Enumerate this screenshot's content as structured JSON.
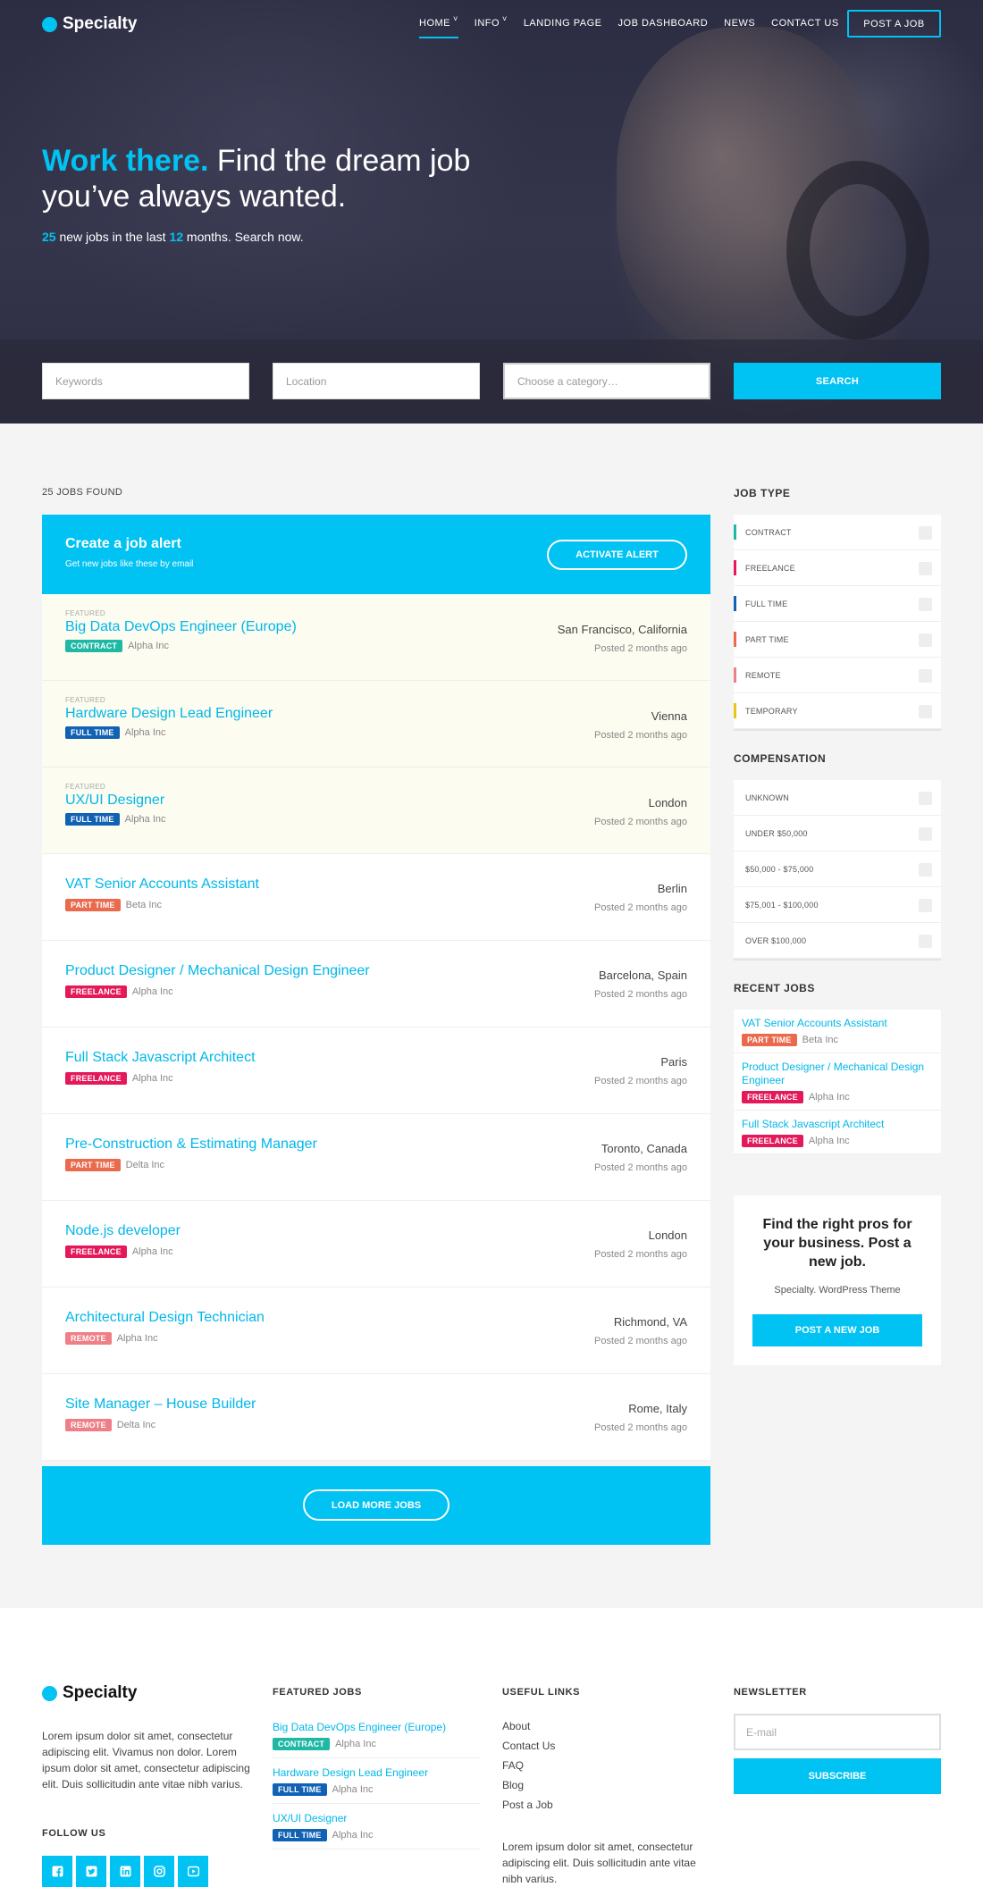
{
  "brand": {
    "name": "Specialty",
    "accent": "#00c2f3"
  },
  "nav": {
    "items": [
      {
        "label": "HOME",
        "has_dropdown": true,
        "active": true
      },
      {
        "label": "INFO",
        "has_dropdown": true,
        "active": false
      },
      {
        "label": "LANDING PAGE",
        "has_dropdown": false,
        "active": false
      },
      {
        "label": "JOB DASHBOARD",
        "has_dropdown": false,
        "active": false
      },
      {
        "label": "NEWS",
        "has_dropdown": false,
        "active": false
      },
      {
        "label": "CONTACT US",
        "has_dropdown": false,
        "active": false
      }
    ],
    "post_job_label": "POST A JOB"
  },
  "hero": {
    "title_accent": "Work there.",
    "title_rest": " Find the dream job you’ve always wanted.",
    "jobs_count": "25",
    "sub_part1": " new jobs in the last ",
    "months": "12",
    "sub_part2": " months. Search now."
  },
  "search": {
    "keywords_placeholder": "Keywords",
    "location_placeholder": "Location",
    "category_placeholder": "Choose a category…",
    "button_label": "SEARCH"
  },
  "results": {
    "count_label": "25 JOBS FOUND",
    "alert": {
      "title": "Create a job alert",
      "subtitle": "Get new jobs like these by email",
      "button_label": "ACTIVATE ALERT"
    },
    "featured_label": "FEATURED",
    "jobs": [
      {
        "title": "Big Data DevOps Engineer (Europe)",
        "type": "CONTRACT",
        "type_color": "#1fb8a5",
        "company": "Alpha Inc",
        "location": "San Francisco, California",
        "posted": "Posted 2 months ago",
        "featured": true
      },
      {
        "title": "Hardware Design Lead Engineer",
        "type": "FULL TIME",
        "type_color": "#1162b4",
        "company": "Alpha Inc",
        "location": "Vienna",
        "posted": "Posted 2 months ago",
        "featured": true
      },
      {
        "title": "UX/UI Designer",
        "type": "FULL TIME",
        "type_color": "#1162b4",
        "company": "Alpha Inc",
        "location": "London",
        "posted": "Posted 2 months ago",
        "featured": true
      },
      {
        "title": "VAT Senior Accounts Assistant",
        "type": "PART TIME",
        "type_color": "#ea6a4e",
        "company": "Beta Inc",
        "location": "Berlin",
        "posted": "Posted 2 months ago",
        "featured": false
      },
      {
        "title": "Product Designer / Mechanical Design Engineer",
        "type": "FREELANCE",
        "type_color": "#e3195a",
        "company": "Alpha Inc",
        "location": "Barcelona, Spain",
        "posted": "Posted 2 months ago",
        "featured": false
      },
      {
        "title": "Full Stack Javascript Architect",
        "type": "FREELANCE",
        "type_color": "#e3195a",
        "company": "Alpha Inc",
        "location": "Paris",
        "posted": "Posted 2 months ago",
        "featured": false
      },
      {
        "title": "Pre-Construction & Estimating Manager",
        "type": "PART TIME",
        "type_color": "#ea6a4e",
        "company": "Delta Inc",
        "location": "Toronto, Canada",
        "posted": "Posted 2 months ago",
        "featured": false
      },
      {
        "title": "Node.js developer",
        "type": "FREELANCE",
        "type_color": "#e3195a",
        "company": "Alpha Inc",
        "location": "London",
        "posted": "Posted 2 months ago",
        "featured": false
      },
      {
        "title": "Architectural Design Technician",
        "type": "REMOTE",
        "type_color": "#ef7f86",
        "company": "Alpha Inc",
        "location": "Richmond, VA",
        "posted": "Posted 2 months ago",
        "featured": false
      },
      {
        "title": "Site Manager – House Builder",
        "type": "REMOTE",
        "type_color": "#ef7f86",
        "company": "Delta Inc",
        "location": "Rome, Italy",
        "posted": "Posted 2 months ago",
        "featured": false
      }
    ],
    "load_more_label": "LOAD MORE JOBS"
  },
  "sidebar": {
    "job_type": {
      "heading": "JOB TYPE",
      "items": [
        {
          "label": "CONTRACT",
          "color": "#1fb8a5"
        },
        {
          "label": "FREELANCE",
          "color": "#e3195a"
        },
        {
          "label": "FULL TIME",
          "color": "#1162b4"
        },
        {
          "label": "PART TIME",
          "color": "#ea6a4e"
        },
        {
          "label": "REMOTE",
          "color": "#ef7f86"
        },
        {
          "label": "TEMPORARY",
          "color": "#e8c516"
        }
      ]
    },
    "compensation": {
      "heading": "COMPENSATION",
      "items": [
        {
          "label": "UNKNOWN"
        },
        {
          "label": "UNDER $50,000"
        },
        {
          "label": "$50,000 - $75,000"
        },
        {
          "label": "$75,001 - $100,000"
        },
        {
          "label": "OVER $100,000"
        }
      ]
    },
    "recent": {
      "heading": "RECENT JOBS",
      "items": [
        {
          "title": "VAT Senior Accounts Assistant",
          "type": "PART TIME",
          "type_color": "#ea6a4e",
          "company": "Beta Inc"
        },
        {
          "title": "Product Designer / Mechanical Design Engineer",
          "type": "FREELANCE",
          "type_color": "#e3195a",
          "company": "Alpha Inc"
        },
        {
          "title": "Full Stack Javascript Architect",
          "type": "FREELANCE",
          "type_color": "#e3195a",
          "company": "Alpha Inc"
        }
      ]
    },
    "promo": {
      "title": "Find the right pros for your business. Post a new job.",
      "subtitle": "Specialty. WordPress Theme",
      "button_label": "POST A NEW JOB"
    }
  },
  "footer": {
    "brand": "Specialty",
    "description": "Lorem ipsum dolor sit amet, consectetur adipiscing elit. Vivamus non dolor. Lorem ipsum dolor sit amet, consectetur adipiscing elit. Duis sollicitudin ante vitae nibh varius.",
    "follow_heading": "FOLLOW US",
    "social": [
      "facebook-icon",
      "twitter-icon",
      "linkedin-icon",
      "instagram-icon",
      "youtube-icon"
    ],
    "featured_heading": "FEATURED JOBS",
    "featured_jobs": [
      {
        "title": "Big Data DevOps Engineer (Europe)",
        "type": "CONTRACT",
        "type_color": "#1fb8a5",
        "company": "Alpha Inc"
      },
      {
        "title": "Hardware Design Lead Engineer",
        "type": "FULL TIME",
        "type_color": "#1162b4",
        "company": "Alpha Inc"
      },
      {
        "title": "UX/UI Designer",
        "type": "FULL TIME",
        "type_color": "#1162b4",
        "company": "Alpha Inc"
      }
    ],
    "links_heading": "USEFUL LINKS",
    "links": [
      "About",
      "Contact Us",
      "FAQ",
      "Blog",
      "Post a Job"
    ],
    "links_description": "Lorem ipsum dolor sit amet, consectetur adipiscing elit. Duis sollicitudin ante vitae nibh varius.",
    "newsletter_heading": "NEWSLETTER",
    "newsletter_placeholder": "E-mail",
    "subscribe_label": "SUBSCRIBE"
  }
}
